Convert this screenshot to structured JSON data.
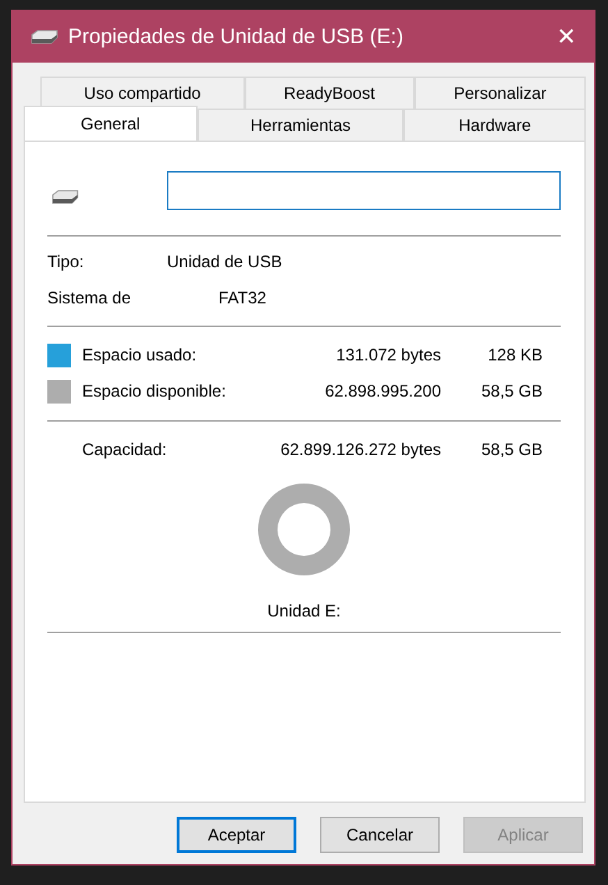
{
  "window": {
    "title": "Propiedades de Unidad de USB (E:)",
    "close": "✕"
  },
  "tab_rows": [
    [
      {
        "label": "Uso compartido",
        "selected": false
      },
      {
        "label": "ReadyBoost",
        "selected": false
      },
      {
        "label": "Personalizar",
        "selected": false
      }
    ],
    [
      {
        "label": "General",
        "selected": true
      },
      {
        "label": "Herramientas",
        "selected": false
      },
      {
        "label": "Hardware",
        "selected": false
      }
    ]
  ],
  "properties": [
    {
      "label": "Tipo:",
      "value": "Unidad de USB"
    },
    {
      "label": "Sistema de",
      "value": "FAT32"
    }
  ],
  "space": [
    {
      "label": "Espacio usado:",
      "bytes": "131.072 bytes",
      "size": "128 KB",
      "color": "#26a0da"
    },
    {
      "label": "Espacio disponible:",
      "bytes": "62.898.995.200",
      "size": "58,5 GB",
      "color": "#adadad"
    }
  ],
  "capacity": {
    "label": "Capacidad:",
    "bytes": "62.899.126.272 bytes",
    "size": "58,5 GB"
  },
  "drive_label": "Unidad E:",
  "buttons": [
    {
      "label": "Aceptar",
      "kind": "default",
      "disabled": false
    },
    {
      "label": "Cancelar",
      "kind": "normal",
      "disabled": false
    },
    {
      "label": "Aplicar",
      "kind": "normal",
      "disabled": true
    }
  ]
}
